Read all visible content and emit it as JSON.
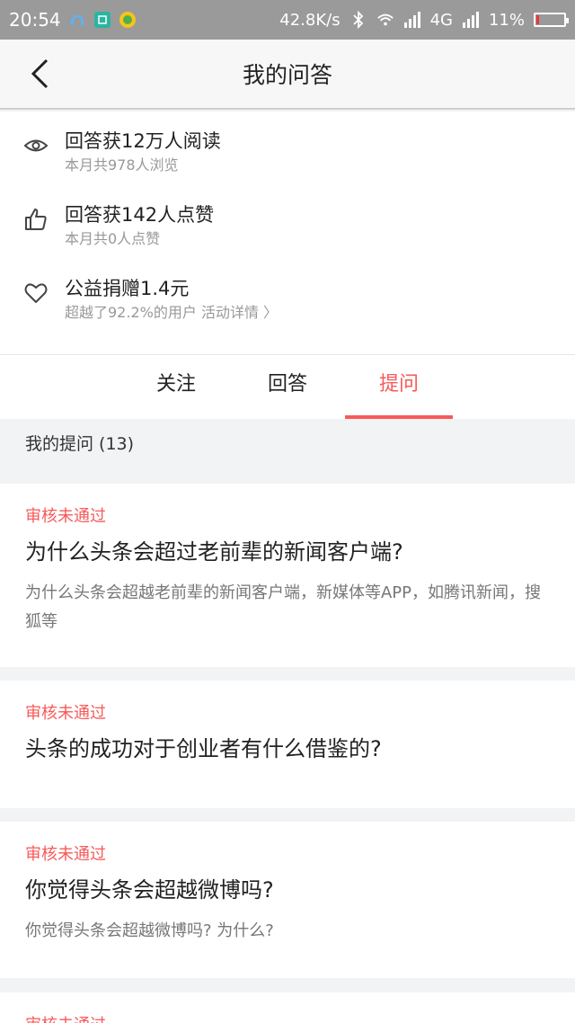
{
  "status_bar": {
    "time": "20:54",
    "network_speed": "42.8K/s",
    "network_type": "4G",
    "battery": "11%",
    "battery_level": 0.11,
    "icons": [
      "headset-icon",
      "scan-icon",
      "app-icon",
      "bluetooth-icon",
      "wifi-icon",
      "signal-icon",
      "battery-icon"
    ]
  },
  "header": {
    "title": "我的问答",
    "back_icon": "chevron-left-icon"
  },
  "stats": [
    {
      "icon": "eye-icon",
      "title": "回答获12万人阅读",
      "sub": "本月共978人浏览"
    },
    {
      "icon": "thumb-up-icon",
      "title": "回答获142人点赞",
      "sub": "本月共0人点赞"
    },
    {
      "icon": "heart-icon",
      "title": "公益捐赠1.4元",
      "sub": "超越了92.2%的用户",
      "link": "活动详情 〉"
    }
  ],
  "tabs": [
    {
      "label": "关注",
      "active": false
    },
    {
      "label": "回答",
      "active": false
    },
    {
      "label": "提问",
      "active": true
    }
  ],
  "section": {
    "heading": "我的提问 (13)"
  },
  "questions": [
    {
      "status": "审核未通过",
      "title": "为什么头条会超过老前辈的新闻客户端?",
      "desc": "为什么头条会超越老前辈的新闻客户端，新媒体等APP，如腾讯新闻，搜狐等"
    },
    {
      "status": "审核未通过",
      "title": "头条的成功对于创业者有什么借鉴的?",
      "desc": ""
    },
    {
      "status": "审核未通过",
      "title": "你觉得头条会超越微博吗?",
      "desc": "你觉得头条会超越微博吗? 为什么?"
    },
    {
      "status": "审核未通过",
      "title": "",
      "desc": ""
    }
  ],
  "colors": {
    "accent": "#f85959",
    "status_bar_bg": "#9a9a9a"
  }
}
